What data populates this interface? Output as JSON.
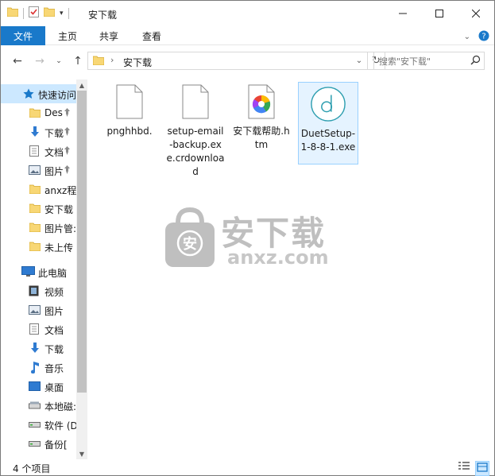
{
  "window": {
    "title": "安下载",
    "controls": [
      "minimize",
      "maximize",
      "close"
    ]
  },
  "qat": {
    "icons": [
      "folder-icon",
      "properties-icon",
      "new-folder-icon",
      "customize-qat-icon"
    ]
  },
  "ribbon": {
    "tabs": [
      {
        "label": "文件",
        "active": true
      },
      {
        "label": "主页"
      },
      {
        "label": "共享"
      },
      {
        "label": "查看"
      }
    ],
    "right_icons": [
      "expand-ribbon-icon",
      "help-icon"
    ]
  },
  "address": {
    "path": "安下载",
    "search_placeholder": "搜索\"安下载\""
  },
  "navpane": {
    "quick_access": {
      "label": "快速访问",
      "items": [
        {
          "label": "Des",
          "icon": "folder",
          "pinned": true
        },
        {
          "label": "下载",
          "icon": "download",
          "pinned": true
        },
        {
          "label": "文档",
          "icon": "document",
          "pinned": true
        },
        {
          "label": "图片",
          "icon": "pictures",
          "pinned": true
        },
        {
          "label": "anxz程",
          "icon": "folder"
        },
        {
          "label": "安下载",
          "icon": "folder"
        },
        {
          "label": "图片管:",
          "icon": "folder"
        },
        {
          "label": "未上传",
          "icon": "folder"
        }
      ]
    },
    "this_pc": {
      "label": "此电脑",
      "items": [
        {
          "label": "视频",
          "icon": "video"
        },
        {
          "label": "图片",
          "icon": "pictures"
        },
        {
          "label": "文档",
          "icon": "document"
        },
        {
          "label": "下载",
          "icon": "download"
        },
        {
          "label": "音乐",
          "icon": "music"
        },
        {
          "label": "桌面",
          "icon": "desktop"
        },
        {
          "label": "本地磁:",
          "icon": "drive"
        },
        {
          "label": "软件 (D",
          "icon": "drive"
        },
        {
          "label": "备份[",
          "icon": "drive"
        }
      ]
    }
  },
  "files": [
    {
      "name": "pnghhbd.",
      "type": "blank"
    },
    {
      "name": "setup-email-backup.exe.crdownload",
      "type": "blank"
    },
    {
      "name": "安下载帮助.htm",
      "type": "htm"
    },
    {
      "name": "DuetSetup-1-8-8-1.exe",
      "type": "duet",
      "selected": true
    }
  ],
  "watermark": {
    "text": "安下载",
    "sub": "anxz.com",
    "logo_text": "安"
  },
  "status": {
    "count_text": "4 个项目"
  },
  "colors": {
    "accent": "#1979ca",
    "selection": "#cce8ff",
    "file_selection": "#e5f3ff",
    "folder": "#f8d775"
  }
}
